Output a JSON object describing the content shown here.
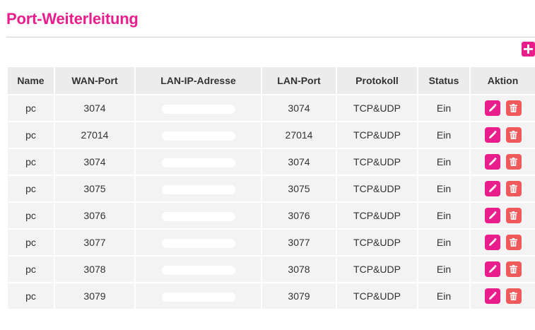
{
  "page": {
    "title": "Port-Weiterleitung"
  },
  "table": {
    "headers": {
      "name": "Name",
      "wan_port": "WAN-Port",
      "lan_ip": "LAN-IP-Adresse",
      "lan_port": "LAN-Port",
      "protocol": "Protokoll",
      "status": "Status",
      "action": "Aktion"
    },
    "rows": [
      {
        "name": "pc",
        "wan_port": "3074",
        "lan_ip": "",
        "lan_port": "3074",
        "protocol": "TCP&UDP",
        "status": "Ein"
      },
      {
        "name": "pc",
        "wan_port": "27014",
        "lan_ip": "",
        "lan_port": "27014",
        "protocol": "TCP&UDP",
        "status": "Ein"
      },
      {
        "name": "pc",
        "wan_port": "3074",
        "lan_ip": "",
        "lan_port": "3074",
        "protocol": "TCP&UDP",
        "status": "Ein"
      },
      {
        "name": "pc",
        "wan_port": "3075",
        "lan_ip": "",
        "lan_port": "3075",
        "protocol": "TCP&UDP",
        "status": "Ein"
      },
      {
        "name": "pc",
        "wan_port": "3076",
        "lan_ip": "",
        "lan_port": "3076",
        "protocol": "TCP&UDP",
        "status": "Ein"
      },
      {
        "name": "pc",
        "wan_port": "3077",
        "lan_ip": "",
        "lan_port": "3077",
        "protocol": "TCP&UDP",
        "status": "Ein"
      },
      {
        "name": "pc",
        "wan_port": "3078",
        "lan_ip": "",
        "lan_port": "3078",
        "protocol": "TCP&UDP",
        "status": "Ein"
      },
      {
        "name": "pc",
        "wan_port": "3079",
        "lan_ip": "",
        "lan_port": "3079",
        "protocol": "TCP&UDP",
        "status": "Ein"
      }
    ]
  },
  "icons": {
    "add": "plus-icon",
    "edit": "pencil-icon",
    "delete": "trash-icon"
  },
  "colors": {
    "accent": "#e91e8c",
    "delete": "#f15a5a",
    "header_bg": "#ececec",
    "row_bg": "#f3f3f3"
  }
}
